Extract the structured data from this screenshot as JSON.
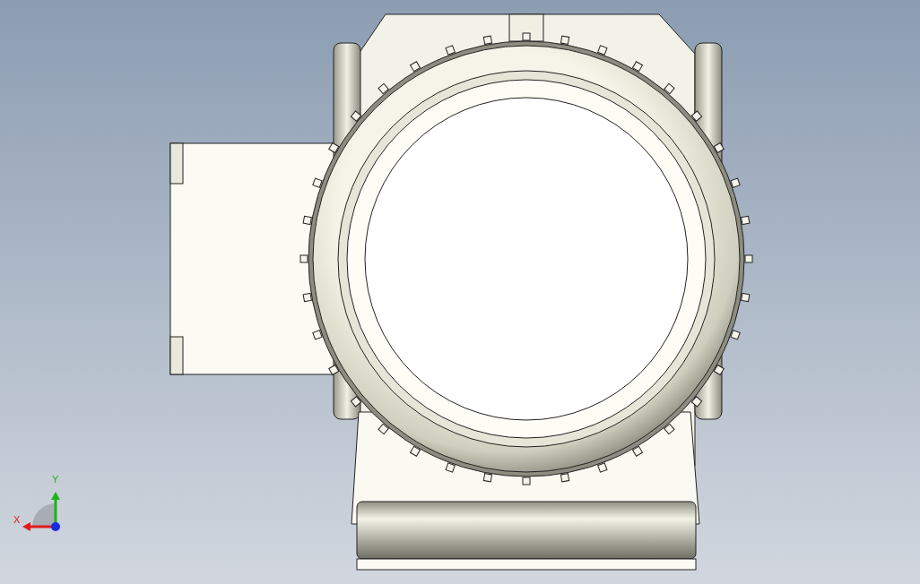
{
  "viewport": {
    "axis_labels": [
      {
        "kind": "horizontal",
        "text": "X"
      },
      {
        "kind": "vertical",
        "text": "Y"
      }
    ]
  }
}
